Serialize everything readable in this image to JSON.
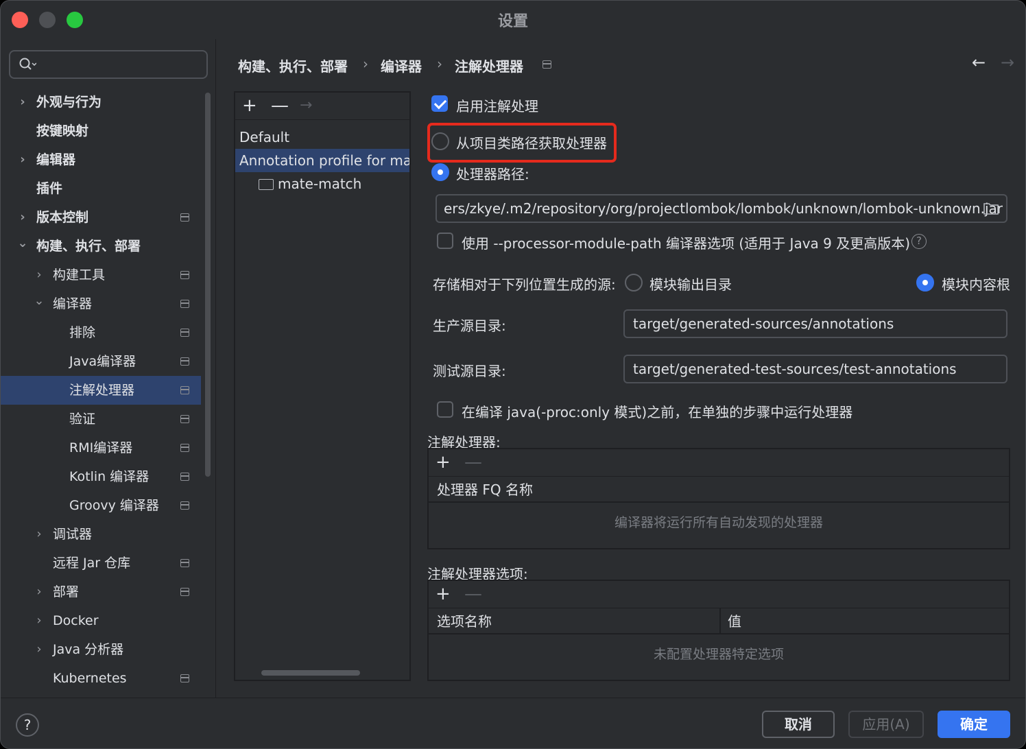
{
  "window": {
    "title": "设置"
  },
  "search": {
    "placeholder": ""
  },
  "sidebar": {
    "items": [
      {
        "label": "外观与行为",
        "chevron": "›"
      },
      {
        "label": "按键映射"
      },
      {
        "label": "编辑器",
        "chevron": "›"
      },
      {
        "label": "插件"
      },
      {
        "label": "版本控制",
        "chevron": "›"
      },
      {
        "label": "构建、执行、部署",
        "chevron": "⌄"
      },
      {
        "label": "构建工具",
        "chevron": "›"
      },
      {
        "label": "编译器",
        "chevron": "⌄"
      },
      {
        "label": "排除"
      },
      {
        "label": "Java编译器"
      },
      {
        "label": "注解处理器"
      },
      {
        "label": "验证"
      },
      {
        "label": "RMI编译器"
      },
      {
        "label": "Kotlin 编译器"
      },
      {
        "label": "Groovy 编译器"
      },
      {
        "label": "调试器",
        "chevron": "›"
      },
      {
        "label": "远程 Jar 仓库"
      },
      {
        "label": "部署",
        "chevron": "›"
      },
      {
        "label": "Docker",
        "chevron": "›"
      },
      {
        "label": "Java 分析器",
        "chevron": "›"
      },
      {
        "label": "Kubernetes"
      }
    ]
  },
  "breadcrumb": {
    "part1": "构建、执行、部署",
    "part2": "编译器",
    "part3": "注解处理器",
    "sep": "›",
    "back": "←",
    "forward": "→"
  },
  "profiles": {
    "add": "+",
    "remove": "—",
    "move": "→",
    "items": [
      "Default",
      "Annotation profile for mate-match",
      "mate-match"
    ]
  },
  "settings": {
    "enable_processing": "启用注解处理",
    "from_classpath": "从项目类路径获取处理器",
    "processor_path_label": "处理器路径:",
    "processor_path_value": "ers/zkye/.m2/repository/org/projectlombok/lombok/unknown/lombok-unknown.jar",
    "module_path_option": "使用 --processor-module-path 编译器选项 (适用于 Java 9 及更高版本)",
    "store_label": "存储相对于下列位置生成的源:",
    "module_output_dir": "模块输出目录",
    "module_content_root": "模块内容根",
    "prod_dir_label": "生产源目录:",
    "prod_dir_value": "target/generated-sources/annotations",
    "test_dir_label": "测试源目录:",
    "test_dir_value": "target/generated-test-sources/test-annotations",
    "run_separately": "在编译 java(-proc:only 模式)之前，在单独的步骤中运行处理器"
  },
  "processors_table": {
    "title": "注解处理器:",
    "add": "+",
    "remove": "—",
    "header": "处理器 FQ 名称",
    "empty": "编译器将运行所有自动发现的处理器"
  },
  "options_table": {
    "title": "注解处理器选项:",
    "add": "+",
    "remove": "—",
    "col_name": "选项名称",
    "col_value": "值",
    "empty": "未配置处理器特定选项"
  },
  "footer": {
    "help": "?",
    "cancel": "取消",
    "apply": "应用(A)",
    "ok": "确定"
  },
  "colors": {
    "accent": "#3574f0",
    "highlight": "#e52a1d",
    "selection": "#2e436e"
  }
}
